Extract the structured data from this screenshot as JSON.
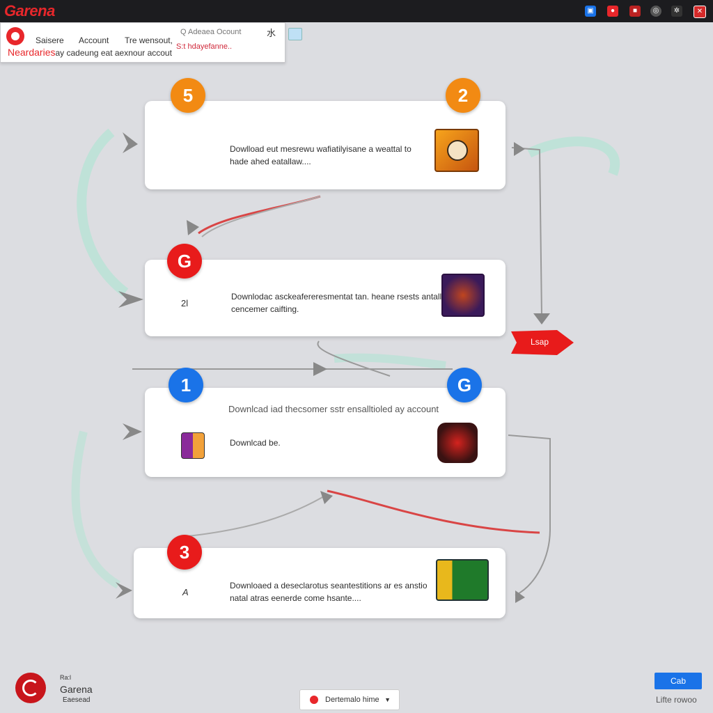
{
  "topbar": {
    "brand": "Garena",
    "icons": [
      "window-icon",
      "record-icon",
      "capture-icon",
      "globe-icon",
      "settings-icon",
      "close-icon"
    ]
  },
  "nav": {
    "tabs": [
      "Saisere",
      "Account",
      "Tre wensout,"
    ],
    "subtitle_red": "Neardaries",
    "subtitle_rest": "ay cadeung eat aexnour accout",
    "search_placeholder": "Q Adeaea Ocount",
    "search_icon_label": "水",
    "search_result": "S:t hdayefanne.."
  },
  "steps": [
    {
      "badge": "5",
      "badge_color": "#f28a13",
      "line1": "Dowlload eut mesrewu wafiatilyisane a weattal to",
      "line2": "hade ahed eatallaw....",
      "icon": "sword-icon",
      "right_badge": "2",
      "right_badge_color": "#f28a13"
    },
    {
      "badge": "G",
      "badge_color": "#e81b1b",
      "line1": "Downlodac asckeafereresmentat tan. heane rsests antall tjo",
      "line2": "cencemer caifting.",
      "icon": "warrior-icon",
      "number": "2l"
    },
    {
      "badge": "1",
      "badge_color": "#1a73e8",
      "header": "Downlcad iad thecsomer sstr ensalltioled ay account",
      "line1": "Downlcad be.",
      "icon": "dragon-icon",
      "right_badge": "G",
      "right_badge_color": "#1a73e8"
    },
    {
      "badge": "3",
      "badge_color": "#e81b1b",
      "line1": "Downloaed a deseclarotus seantestitions ar es anstio",
      "line2": "natal atras eenerde come hsante....",
      "icon": "flag-icon",
      "number": "A"
    }
  ],
  "tag": {
    "label": "Lsap"
  },
  "footer": {
    "small": "Ra:l",
    "brand": "Garena",
    "tagline": "Eaesead",
    "language": "Dertemalo hime",
    "cta": "Cab",
    "cta_sub": "Lifte rowoo"
  },
  "colors": {
    "accent": "#e8272b",
    "blue": "#1a73e8",
    "orange": "#f28a13",
    "card": "#ffffff",
    "bg": "#dcdde1"
  }
}
